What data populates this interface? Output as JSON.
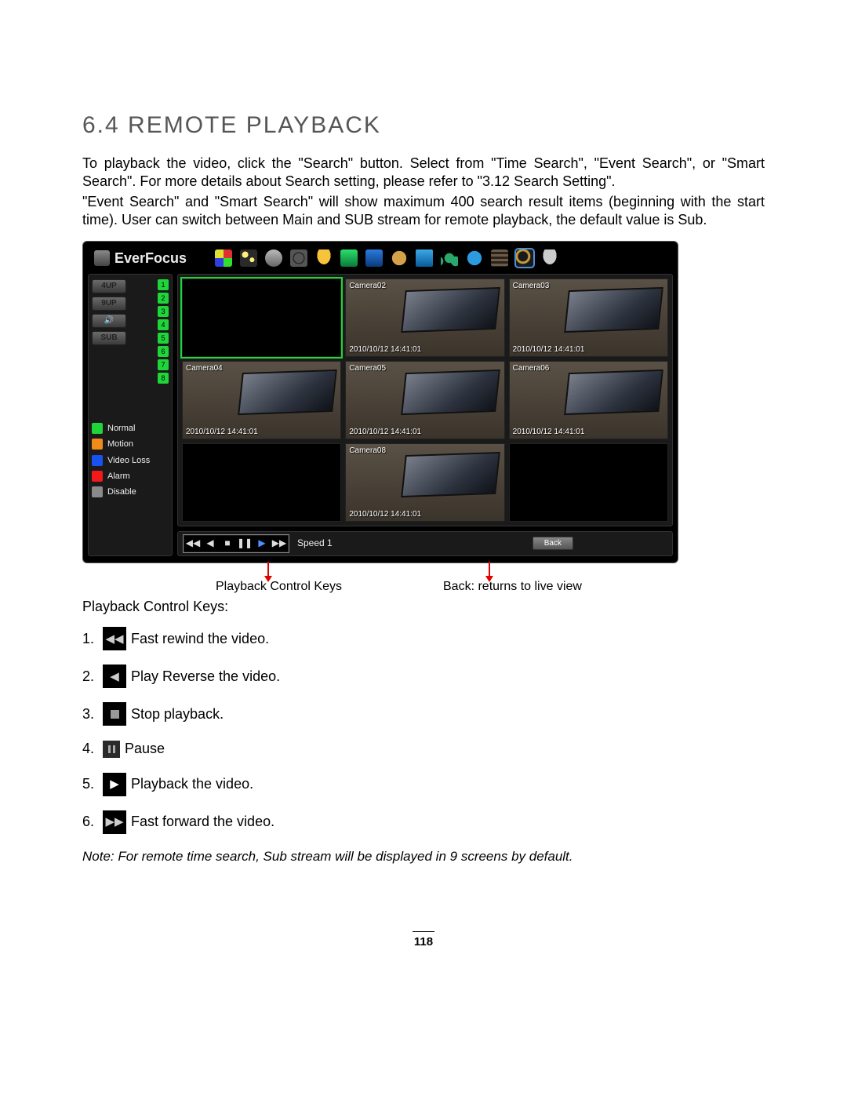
{
  "section": {
    "heading": "6.4  REMOTE PLAYBACK",
    "para1": "To playback the video, click the \"Search\" button. Select from \"Time Search\", \"Event Search\", or \"Smart Search\".  For more details about Search setting, please refer to \"3.12 Search Setting\".",
    "para2": "\"Event Search\" and \"Smart Search\" will show maximum 400 search result items (beginning with the start time).  User can switch between Main and SUB stream for remote playback, the default value is Sub."
  },
  "app": {
    "brand": "EverFocus",
    "view_buttons": [
      "4UP",
      "9UP",
      "🔊",
      "SUB"
    ],
    "camera_numbers": [
      "1",
      "2",
      "3",
      "4",
      "5",
      "6",
      "7",
      "8"
    ],
    "legend": [
      {
        "color": "sw-normal",
        "label": "Normal"
      },
      {
        "color": "sw-motion",
        "label": "Motion"
      },
      {
        "color": "sw-videoloss",
        "label": "Video Loss"
      },
      {
        "color": "sw-alarm",
        "label": "Alarm"
      },
      {
        "color": "sw-disable",
        "label": "Disable"
      }
    ],
    "cells": [
      {
        "label": "",
        "ts": "",
        "type": "active"
      },
      {
        "label": "Camera02",
        "ts": "2010/10/12 14:41:01",
        "type": "feed"
      },
      {
        "label": "Camera03",
        "ts": "2010/10/12 14:41:01",
        "type": "feed"
      },
      {
        "label": "Camera04",
        "ts": "2010/10/12 14:41:01",
        "type": "feed"
      },
      {
        "label": "Camera05",
        "ts": "2010/10/12 14:41:01",
        "type": "feed"
      },
      {
        "label": "Camera06",
        "ts": "2010/10/12 14:41:01",
        "type": "feed"
      },
      {
        "label": "",
        "ts": "",
        "type": "empty"
      },
      {
        "label": "Camera08",
        "ts": "2010/10/12 14:41:01",
        "type": "feed"
      },
      {
        "label": "",
        "ts": "",
        "type": "empty"
      }
    ],
    "speed_label": "Speed 1",
    "back_label": "Back"
  },
  "callouts": {
    "left": "Playback Control Keys",
    "right": "Back: returns to live view"
  },
  "keys_intro": "Playback Control Keys:",
  "keys": [
    {
      "n": "1.",
      "desc": "Fast rewind the video."
    },
    {
      "n": "2.",
      "desc": "Play Reverse the video."
    },
    {
      "n": "3.",
      "desc": "Stop playback."
    },
    {
      "n": "4.",
      "desc": "Pause"
    },
    {
      "n": "5.",
      "desc": "Playback the video."
    },
    {
      "n": "6.",
      "desc": "Fast forward the video."
    }
  ],
  "note": "Note: For remote time search, Sub stream will be displayed in 9 screens by default.",
  "page_number": "118"
}
